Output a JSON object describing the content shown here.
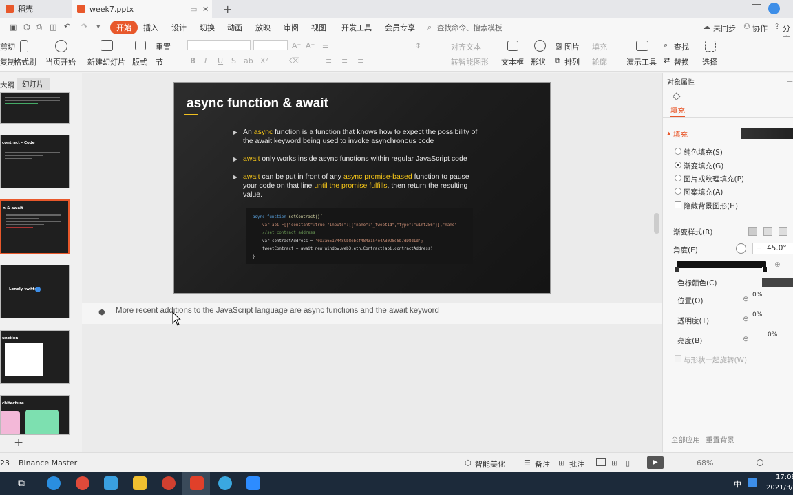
{
  "tabs": [
    {
      "label": "稻壳"
    },
    {
      "label": "week7.pptx"
    }
  ],
  "menu": [
    "开始",
    "插入",
    "设计",
    "切换",
    "动画",
    "放映",
    "审阅",
    "视图",
    "开发工具",
    "会员专享"
  ],
  "menu_search_placeholder": "查找命令、搜索模板",
  "menu_right": {
    "sync": "未同步",
    "collab": "协作",
    "share": "分享"
  },
  "ribbon": {
    "cut": "剪切",
    "copy": "复制",
    "format_painter": "格式刷",
    "play_current": "当页开始",
    "new_slide": "新建幻灯片",
    "layout": "版式",
    "section": "节",
    "reset": "重置",
    "align_text": "对齐文本",
    "convert_smartart": "转智能图形",
    "textbox": "文本框",
    "shape": "形状",
    "picture": "图片",
    "fill": "填充",
    "arrange": "排列",
    "outline": "轮廓",
    "presentation_tools": "演示工具",
    "find": "查找",
    "replace": "替换",
    "select": "选择"
  },
  "left_panel": {
    "tab_outline": "大纲",
    "tab_slides": "幻灯片"
  },
  "thumbnails": [
    {
      "title": ""
    },
    {
      "title": "contract - Code"
    },
    {
      "title": "n & await"
    },
    {
      "title": "Lonely twitter"
    },
    {
      "title": "unction"
    },
    {
      "title": "chitecture"
    }
  ],
  "slide": {
    "title": "async function & await",
    "bullets": [
      {
        "pre": "An ",
        "hl1": "async",
        "mid": " function is a function that knows how to expect the possibility of the await keyword being used to invoke asynchronous code",
        "hl2": "",
        "post": ""
      },
      {
        "pre": "",
        "hl1": "await",
        "mid": " only works inside async functions within regular JavaScript code",
        "hl2": "",
        "post": ""
      },
      {
        "pre": "",
        "hl1": "await",
        "mid": " can be put in front of any ",
        "hl2": "async promise-based",
        "post": " function to pause your code on that line "
      }
    ],
    "bullet3_hl3": "until the promise fulfills",
    "bullet3_post2": ", then return the resulting value.",
    "code": {
      "line1_kw": "async function",
      "line1_fn": " setContract(){",
      "line2": "var abi =[{\"constant\":true,\"inputs\":[{\"name\":\"_tweetId\",\"type\":\"uint256\"}],\"name\":",
      "line3": "//set contract address",
      "line4_var": "var contractAddress = ",
      "line4_str": "'0x3a65174489b8ebcf4843154e4AB0D8d8b7dD8d1d';",
      "line5": "tweetContract = await new window.web3.eth.Contract(abi,contractAddress);",
      "line6": "}"
    }
  },
  "notes": "More recent additions to the JavaScript language are async functions and the await keyword",
  "right_panel": {
    "header": "对象属性",
    "tab_fill": "填充",
    "section_fill": "填充",
    "options": [
      "纯色填充(S)",
      "渐变填充(G)",
      "图片或纹理填充(P)",
      "图案填充(A)"
    ],
    "hide_bg": "隐藏背景图形(H)",
    "gradient_style": "渐变样式(R)",
    "angle_label": "角度(E)",
    "angle_value": "45.0°",
    "stop_color": "色标颜色(C)",
    "position": "位置(O)",
    "position_val": "0%",
    "transparency": "透明度(T)",
    "transparency_val": "0%",
    "brightness": "亮度(B)",
    "brightness_val": "0%",
    "rotate_with_shape": "与形状一起旋转(W)",
    "apply_all": "全部应用",
    "reset_bg": "重置背景"
  },
  "status": {
    "slide_no": "23",
    "theme": "Binance Master",
    "smart": "智能美化",
    "notes": "备注",
    "comment": "批注",
    "zoom": "68%"
  },
  "taskbar": {
    "time": "17:09",
    "date": "2021/3/",
    "ime": "中"
  }
}
